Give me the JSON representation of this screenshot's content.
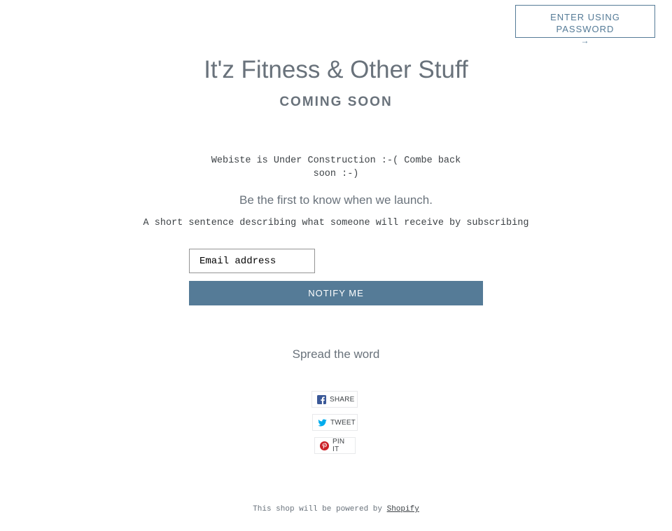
{
  "header": {
    "password_label": "ENTER USING PASSWORD",
    "password_arrow": "→"
  },
  "hero": {
    "shop_title": "It'z Fitness & Other Stuff",
    "status": "COMING SOON"
  },
  "main": {
    "construction_message": "Webiste is Under Construction :-( Combe back soon :-)",
    "launch_heading": "Be the first to know when we launch.",
    "launch_description": "A short sentence describing what someone will receive by subscribing",
    "email_placeholder": "Email address",
    "email_value": "",
    "notify_label": "NOTIFY ME"
  },
  "share": {
    "heading": "Spread the word",
    "buttons": [
      {
        "label": "SHARE",
        "icon": "facebook-icon",
        "color": "#3b5998"
      },
      {
        "label": "TWEET",
        "icon": "twitter-icon",
        "color": "#00aced"
      },
      {
        "label": "PIN IT",
        "icon": "pinterest-icon",
        "color": "#cb2027"
      }
    ]
  },
  "footer": {
    "prefix": "This shop will be powered by",
    "link_label": "Shopify"
  },
  "colors": {
    "accent": "#557b97",
    "text": "#69727b",
    "body_text": "#3d4246"
  }
}
